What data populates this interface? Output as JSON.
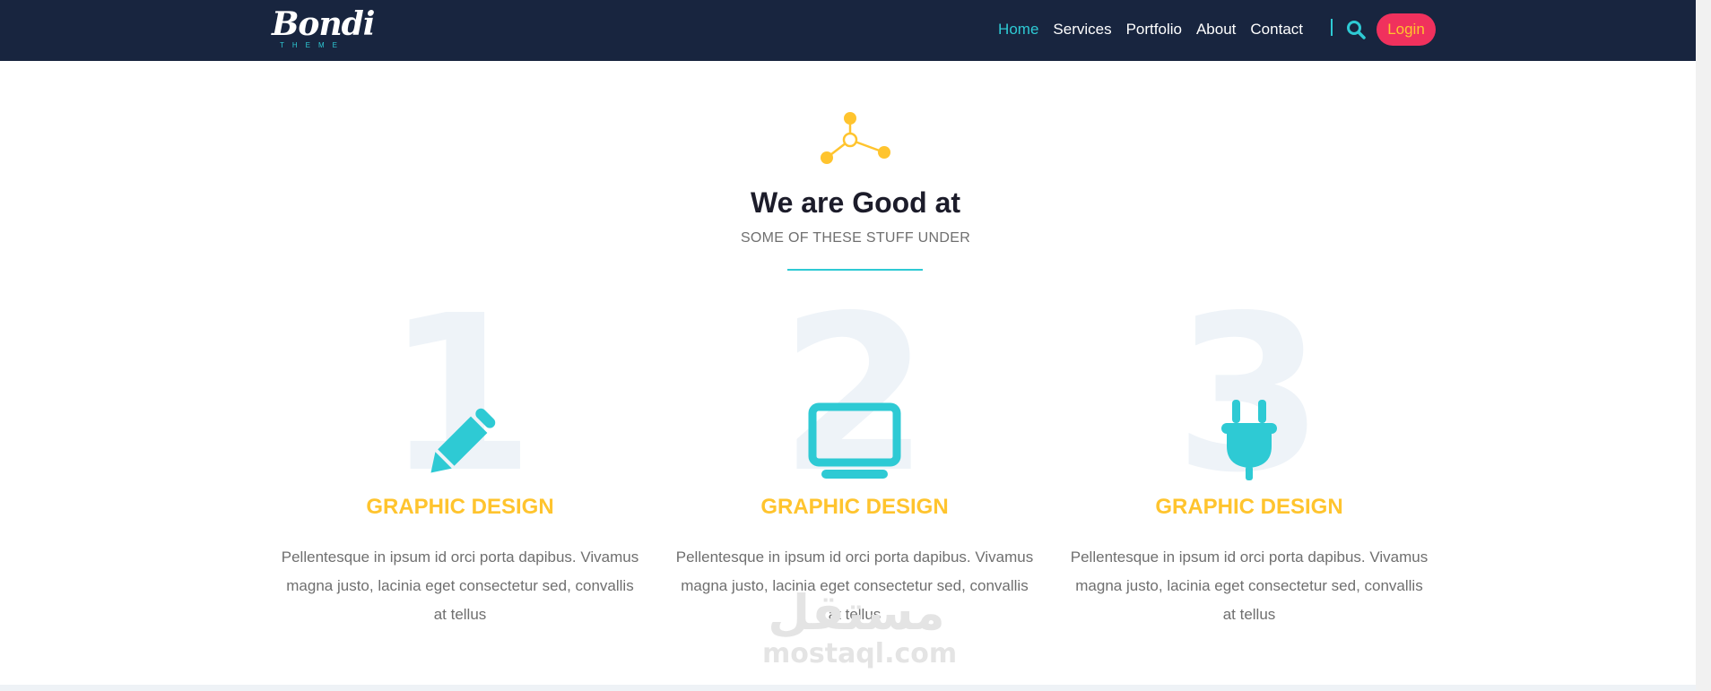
{
  "colors": {
    "nav_bg": "#18253f",
    "accent_teal": "#2ecad4",
    "accent_yellow": "#ffc42e",
    "login_bg": "#f0315d"
  },
  "nav": {
    "logo": {
      "script": "Bondi",
      "sub": "THEME"
    },
    "menu": [
      {
        "label": "Home",
        "active": true
      },
      {
        "label": "Services",
        "active": false
      },
      {
        "label": "Portfolio",
        "active": false
      },
      {
        "label": "About",
        "active": false
      },
      {
        "label": "Contact",
        "active": false
      }
    ],
    "search_icon": "search-icon",
    "login_label": "Login"
  },
  "section": {
    "icon": "network-nodes-icon",
    "title": "We are Good at",
    "subtitle": "SOME OF THESE STUFF UNDER"
  },
  "features": [
    {
      "number": "1",
      "icon": "pencil-icon",
      "title": "GRAPHIC DESIGN",
      "text": "Pellentesque in ipsum id orci porta dapibus. Vivamus magna justo, lacinia eget consectetur sed, convallis at tellus"
    },
    {
      "number": "2",
      "icon": "monitor-icon",
      "title": "GRAPHIC DESIGN",
      "text": "Pellentesque in ipsum id orci porta dapibus. Vivamus magna justo, lacinia eget consectetur sed, convallis at tellus"
    },
    {
      "number": "3",
      "icon": "plug-icon",
      "title": "GRAPHIC DESIGN",
      "text": "Pellentesque in ipsum id orci porta dapibus. Vivamus magna justo, lacinia eget consectetur sed, convallis at tellus"
    }
  ],
  "watermark": {
    "arabic": "مستقل",
    "latin": "mostaql.com"
  }
}
